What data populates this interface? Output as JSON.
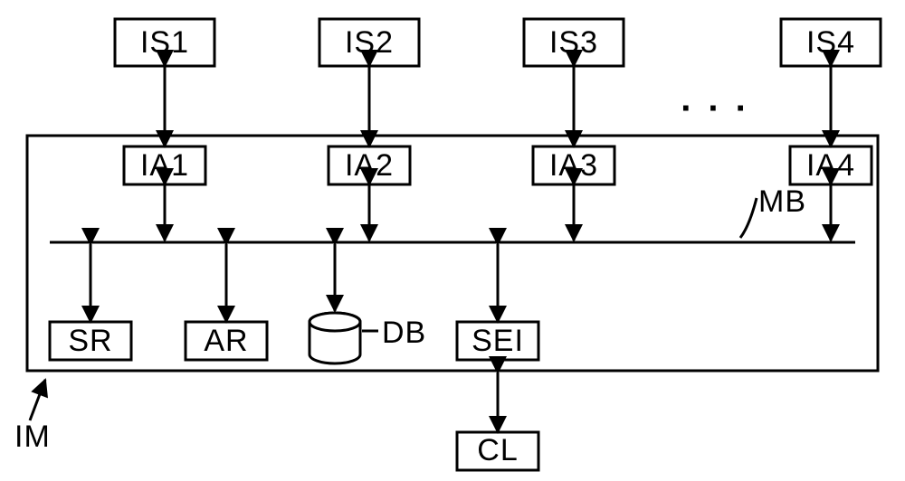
{
  "top_nodes": [
    {
      "id": "is1",
      "label": "IS1"
    },
    {
      "id": "is2",
      "label": "IS2"
    },
    {
      "id": "is3",
      "label": "IS3"
    },
    {
      "id": "is4",
      "label": "IS4"
    }
  ],
  "adapter_nodes": [
    {
      "id": "ia1",
      "label": "IA1"
    },
    {
      "id": "ia2",
      "label": "IA2"
    },
    {
      "id": "ia3",
      "label": "IA3"
    },
    {
      "id": "ia4",
      "label": "IA4"
    }
  ],
  "bottom_nodes": {
    "sr": {
      "label": "SR"
    },
    "ar": {
      "label": "AR"
    },
    "sei": {
      "label": "SEI"
    },
    "cl": {
      "label": "CL"
    }
  },
  "db_label": "DB",
  "bus_label": "MB",
  "container_label": "IM",
  "ellipsis": ". . ."
}
